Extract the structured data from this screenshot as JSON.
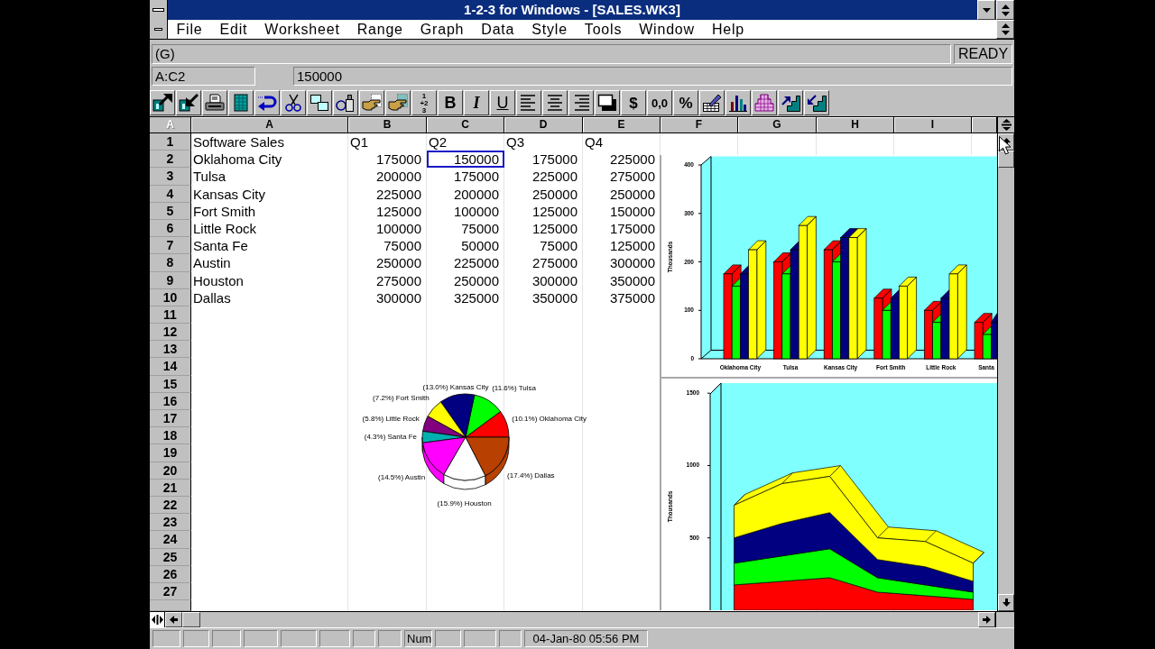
{
  "window": {
    "title": "1-2-3 for Windows - [SALES.WK3]"
  },
  "menu": [
    "File",
    "Edit",
    "Worksheet",
    "Range",
    "Graph",
    "Data",
    "Style",
    "Tools",
    "Window",
    "Help"
  ],
  "edit_line": {
    "format": "(G)",
    "mode": "READY",
    "address": "A:C2",
    "contents": "150000"
  },
  "toolbar": [
    {
      "kind": "icon"
    },
    {
      "kind": "icon"
    },
    {
      "kind": "icon"
    },
    {
      "kind": "icon"
    },
    {
      "kind": "icon"
    },
    {
      "kind": "icon"
    },
    {
      "kind": "icon"
    },
    {
      "kind": "icon"
    },
    {
      "kind": "icon"
    },
    {
      "kind": "icon"
    },
    {
      "kind": "stack",
      "lines": [
        "1",
        "+2",
        "3"
      ]
    },
    {
      "kind": "bold",
      "label": "B"
    },
    {
      "kind": "italic",
      "label": "I"
    },
    {
      "kind": "underline",
      "label": "U"
    },
    {
      "kind": "icon"
    },
    {
      "kind": "icon"
    },
    {
      "kind": "icon"
    },
    {
      "kind": "icon"
    },
    {
      "kind": "text",
      "label": "$"
    },
    {
      "kind": "text",
      "label": "0,0"
    },
    {
      "kind": "text",
      "label": "%"
    },
    {
      "kind": "icon"
    },
    {
      "kind": "icon"
    },
    {
      "kind": "icon"
    },
    {
      "kind": "icon"
    },
    {
      "kind": "icon"
    }
  ],
  "sheet": {
    "sheet_letter": "A",
    "columns": [
      "A",
      "B",
      "C",
      "D",
      "E",
      "F",
      "G",
      "H",
      "I"
    ],
    "rows": [
      {
        "header": "1",
        "cells": [
          {
            "text": "Software Sales",
            "kind": "label",
            "selected": false
          },
          {
            "text": "Q1",
            "kind": "label",
            "selected": false
          },
          {
            "text": "Q2",
            "kind": "label",
            "selected": false
          },
          {
            "text": "Q3",
            "kind": "label",
            "selected": false
          },
          {
            "text": "Q4",
            "kind": "label",
            "selected": false
          }
        ]
      },
      {
        "header": "2",
        "cells": [
          {
            "text": "Oklahoma City",
            "kind": "label",
            "selected": false
          },
          {
            "text": "175000",
            "kind": "number",
            "selected": false
          },
          {
            "text": "150000",
            "kind": "number",
            "selected": true
          },
          {
            "text": "175000",
            "kind": "number",
            "selected": false
          },
          {
            "text": "225000",
            "kind": "number",
            "selected": false
          }
        ]
      },
      {
        "header": "3",
        "cells": [
          {
            "text": "Tulsa",
            "kind": "label",
            "selected": false
          },
          {
            "text": "200000",
            "kind": "number",
            "selected": false
          },
          {
            "text": "175000",
            "kind": "number",
            "selected": false
          },
          {
            "text": "225000",
            "kind": "number",
            "selected": false
          },
          {
            "text": "275000",
            "kind": "number",
            "selected": false
          }
        ]
      },
      {
        "header": "4",
        "cells": [
          {
            "text": "Kansas City",
            "kind": "label",
            "selected": false
          },
          {
            "text": "225000",
            "kind": "number",
            "selected": false
          },
          {
            "text": "200000",
            "kind": "number",
            "selected": false
          },
          {
            "text": "250000",
            "kind": "number",
            "selected": false
          },
          {
            "text": "250000",
            "kind": "number",
            "selected": false
          }
        ]
      },
      {
        "header": "5",
        "cells": [
          {
            "text": "Fort Smith",
            "kind": "label",
            "selected": false
          },
          {
            "text": "125000",
            "kind": "number",
            "selected": false
          },
          {
            "text": "100000",
            "kind": "number",
            "selected": false
          },
          {
            "text": "125000",
            "kind": "number",
            "selected": false
          },
          {
            "text": "150000",
            "kind": "number",
            "selected": false
          }
        ]
      },
      {
        "header": "6",
        "cells": [
          {
            "text": "Little Rock",
            "kind": "label",
            "selected": false
          },
          {
            "text": "100000",
            "kind": "number",
            "selected": false
          },
          {
            "text": "75000",
            "kind": "number",
            "selected": false
          },
          {
            "text": "125000",
            "kind": "number",
            "selected": false
          },
          {
            "text": "175000",
            "kind": "number",
            "selected": false
          }
        ]
      },
      {
        "header": "7",
        "cells": [
          {
            "text": "Santa Fe",
            "kind": "label",
            "selected": false
          },
          {
            "text": "75000",
            "kind": "number",
            "selected": false
          },
          {
            "text": "50000",
            "kind": "number",
            "selected": false
          },
          {
            "text": "75000",
            "kind": "number",
            "selected": false
          },
          {
            "text": "125000",
            "kind": "number",
            "selected": false
          }
        ]
      },
      {
        "header": "8",
        "cells": [
          {
            "text": "Austin",
            "kind": "label",
            "selected": false
          },
          {
            "text": "250000",
            "kind": "number",
            "selected": false
          },
          {
            "text": "225000",
            "kind": "number",
            "selected": false
          },
          {
            "text": "275000",
            "kind": "number",
            "selected": false
          },
          {
            "text": "300000",
            "kind": "number",
            "selected": false
          }
        ]
      },
      {
        "header": "9",
        "cells": [
          {
            "text": "Houston",
            "kind": "label",
            "selected": false
          },
          {
            "text": "275000",
            "kind": "number",
            "selected": false
          },
          {
            "text": "250000",
            "kind": "number",
            "selected": false
          },
          {
            "text": "300000",
            "kind": "number",
            "selected": false
          },
          {
            "text": "350000",
            "kind": "number",
            "selected": false
          }
        ]
      },
      {
        "header": "10",
        "cells": [
          {
            "text": "Dallas",
            "kind": "label",
            "selected": false
          },
          {
            "text": "300000",
            "kind": "number",
            "selected": false
          },
          {
            "text": "325000",
            "kind": "number",
            "selected": false
          },
          {
            "text": "350000",
            "kind": "number",
            "selected": false
          },
          {
            "text": "375000",
            "kind": "number",
            "selected": false
          }
        ]
      },
      {
        "header": "11"
      },
      {
        "header": "12"
      },
      {
        "header": "13"
      },
      {
        "header": "14"
      },
      {
        "header": "15"
      },
      {
        "header": "16"
      },
      {
        "header": "17"
      },
      {
        "header": "18"
      },
      {
        "header": "19"
      },
      {
        "header": "20"
      },
      {
        "header": "21"
      },
      {
        "header": "22"
      },
      {
        "header": "23"
      },
      {
        "header": "24"
      },
      {
        "header": "25"
      },
      {
        "header": "26"
      },
      {
        "header": "27"
      }
    ],
    "graphs": [
      {
        "chart_data": {
          "type": "bar",
          "ylabel": "Thousands",
          "categories": [
            "Oklahoma City",
            "Tulsa",
            "Kansas City",
            "Fort Smith",
            "Little Rock",
            "Santa"
          ],
          "series": [
            {
              "color": "#ff0000",
              "values": [
                175,
                200,
                225,
                125,
                100,
                75
              ]
            },
            {
              "color": "#00ff00",
              "values": [
                150,
                175,
                200,
                100,
                75,
                50
              ]
            },
            {
              "color": "#000080",
              "values": [
                175,
                225,
                250,
                125,
                125,
                75
              ]
            },
            {
              "color": "#ffff00",
              "values": [
                225,
                275,
                250,
                150,
                175,
                null
              ]
            }
          ],
          "ylim": [
            0,
            400
          ],
          "yticks": [
            0,
            100,
            200,
            300,
            400
          ]
        }
      },
      {
        "chart_data": {
          "type": "pie",
          "categories": [
            "Oklahoma City",
            "Tulsa",
            "Kansas City",
            "Fort Smith",
            "Little Rock",
            "Santa Fe",
            "Austin",
            "Houston",
            "Dallas"
          ],
          "values": [
            10.1,
            11.6,
            13.0,
            7.2,
            5.8,
            4.3,
            14.5,
            15.9,
            17.4
          ],
          "value_labels": [
            "(10.1%)",
            "(11.6%)",
            "(13.0%)",
            "(7.2%)",
            "(5.8%)",
            "(4.3%)",
            "(14.5%)",
            "(15.9%)",
            "(17.4%)"
          ],
          "colors": [
            "#ff0000",
            "#00ff00",
            "#000080",
            "#ffff00",
            "#800080",
            "#00b0b0",
            "#ff00ff",
            "#ffffff",
            "#b84000"
          ]
        }
      },
      {
        "chart_data": {
          "type": "area",
          "stacked": true,
          "ylabel": "Thousands",
          "categories": [
            null,
            null,
            null,
            null,
            null,
            null
          ],
          "series": [
            {
              "color": "#ff0000",
              "values": [
                175,
                200,
                225,
                125,
                100,
                75
              ]
            },
            {
              "color": "#00ff00",
              "values": [
                150,
                175,
                200,
                100,
                75,
                50
              ]
            },
            {
              "color": "#000080",
              "values": [
                175,
                225,
                250,
                125,
                125,
                75
              ]
            },
            {
              "color": "#ffff00",
              "values": [
                225,
                275,
                250,
                150,
                175,
                125
              ]
            }
          ],
          "ylim": [
            0,
            1570
          ],
          "yticks": [
            500,
            1000,
            1500
          ]
        }
      }
    ]
  },
  "status_bar": {
    "panels": [
      {
        "kind": "empty"
      },
      {
        "kind": "empty"
      },
      {
        "kind": "empty"
      },
      {
        "kind": "empty"
      },
      {
        "kind": "empty"
      },
      {
        "kind": "empty"
      },
      {
        "kind": "empty"
      },
      {
        "kind": "empty"
      },
      {
        "kind": "text",
        "text": "Num"
      },
      {
        "kind": "empty"
      },
      {
        "kind": "empty"
      },
      {
        "kind": "empty"
      },
      {
        "kind": "text",
        "text": "04-Jan-80 05:56 PM"
      }
    ]
  }
}
